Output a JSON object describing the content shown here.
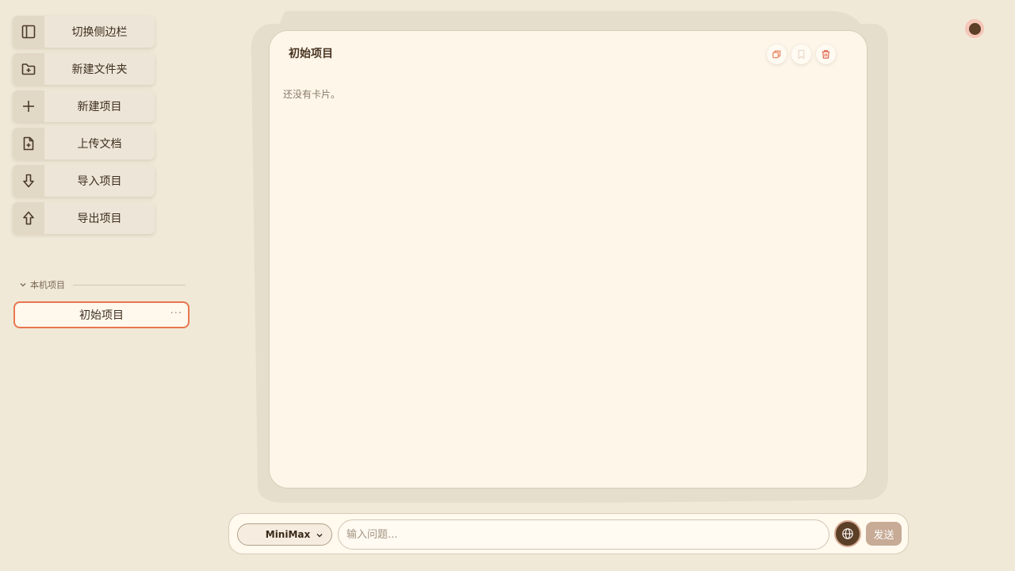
{
  "sidebar": {
    "actions": [
      {
        "label": "切换侧边栏",
        "icon": "sidebar-toggle-icon"
      },
      {
        "label": "新建文件夹",
        "icon": "folder-plus-icon"
      },
      {
        "label": "新建项目",
        "icon": "plus-icon"
      },
      {
        "label": "上传文档",
        "icon": "file-plus-icon"
      },
      {
        "label": "导入项目",
        "icon": "arrow-down-icon"
      },
      {
        "label": "导出项目",
        "icon": "arrow-up-icon"
      }
    ],
    "section_title": "本机项目",
    "projects": [
      {
        "name": "初始项目",
        "more": "···"
      }
    ]
  },
  "card": {
    "title": "初始项目",
    "empty_message": "还没有卡片。",
    "tools": [
      "copy-icon",
      "bookmark-icon",
      "trash-icon"
    ]
  },
  "chatbar": {
    "model": "MiniMax",
    "input_placeholder": "输入问题...",
    "input_value": "",
    "send_label": "发送",
    "globe_icon": "globe-icon"
  },
  "colors": {
    "background": "#f0e9d8",
    "accent": "#e8764e",
    "dark_brown": "#5c3f27",
    "card": "#fdf6e9",
    "send": "#c7ab96"
  }
}
